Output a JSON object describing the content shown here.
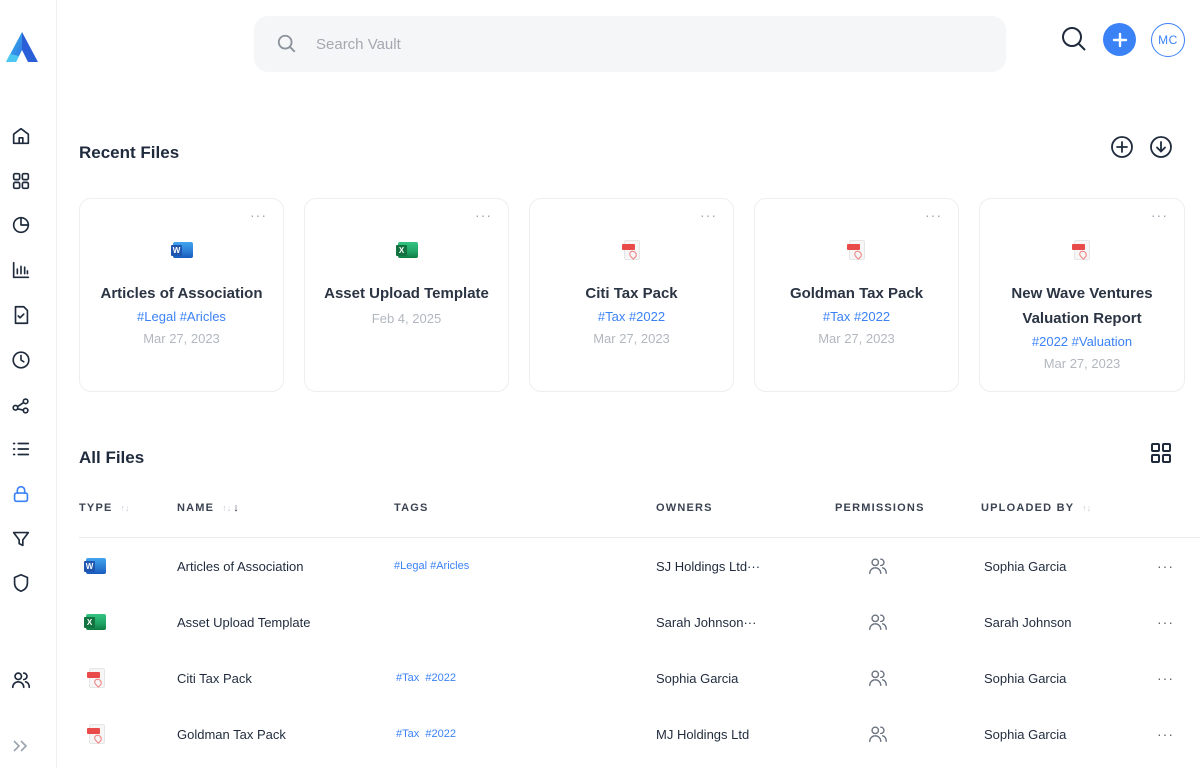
{
  "search": {
    "placeholder": "Search Vault"
  },
  "header": {
    "avatar_initials": "MC"
  },
  "colors": {
    "accent": "#3b82f6",
    "text": "#1f2b3d",
    "muted": "#b2b7bf"
  },
  "sidebar": {
    "items": [
      {
        "name": "home-icon"
      },
      {
        "name": "dashboard-grid-icon"
      },
      {
        "name": "pie-chart-icon"
      },
      {
        "name": "bar-chart-icon"
      },
      {
        "name": "document-check-icon"
      },
      {
        "name": "clock-icon"
      },
      {
        "name": "share-icon"
      },
      {
        "name": "list-icon"
      },
      {
        "name": "lock-icon",
        "active": true
      },
      {
        "name": "filter-icon"
      },
      {
        "name": "shield-icon"
      },
      {
        "name": "users-icon"
      }
    ],
    "expand_icon": "double-chevron-right-icon"
  },
  "recent": {
    "title": "Recent Files",
    "cards": [
      {
        "type": "word",
        "title": "Articles of Association",
        "tags": "#Legal #Aricles",
        "date": "Mar 27, 2023",
        "more": "···"
      },
      {
        "type": "excel",
        "title": "Asset Upload Template",
        "tags": "",
        "date": "Feb 4, 2025",
        "more": "···"
      },
      {
        "type": "pdf",
        "title": "Citi Tax Pack",
        "tags": "#Tax #2022",
        "date": "Mar 27, 2023",
        "more": "···"
      },
      {
        "type": "pdf",
        "title": "Goldman Tax Pack",
        "tags": "#Tax #2022",
        "date": "Mar 27, 2023",
        "more": "···"
      },
      {
        "type": "pdf",
        "title": "New Wave Ventures Valuation Report",
        "tags": "#2022 #Valuation",
        "date": "Mar 27, 2023",
        "more": "···"
      }
    ]
  },
  "all_files": {
    "title": "All Files",
    "columns": {
      "type": "TYPE",
      "name": "NAME",
      "tags": "TAGS",
      "owners": "OWNERS",
      "permissions": "PERMISSIONS",
      "uploaded_by": "UPLOADED BY"
    },
    "sort_icons": {
      "inactive": "↑↓",
      "active": "↓"
    },
    "rows": [
      {
        "type": "word",
        "name": "Articles of Association",
        "tags": "#Legal #Aricles",
        "owners": "SJ Holdings Ltd···",
        "uploaded_by": "Sophia Garcia",
        "more": "···"
      },
      {
        "type": "excel",
        "name": "Asset Upload Template",
        "tags": "",
        "owners": "Sarah Johnson···",
        "uploaded_by": "Sarah Johnson",
        "more": "···"
      },
      {
        "type": "pdf",
        "name": "Citi Tax Pack",
        "tags": "#Tax  #2022",
        "owners": "Sophia Garcia",
        "uploaded_by": "Sophia Garcia",
        "more": "···"
      },
      {
        "type": "pdf",
        "name": "Goldman Tax Pack",
        "tags": "#Tax  #2022",
        "owners": "MJ Holdings Ltd",
        "uploaded_by": "Sophia Garcia",
        "more": "···"
      }
    ]
  }
}
